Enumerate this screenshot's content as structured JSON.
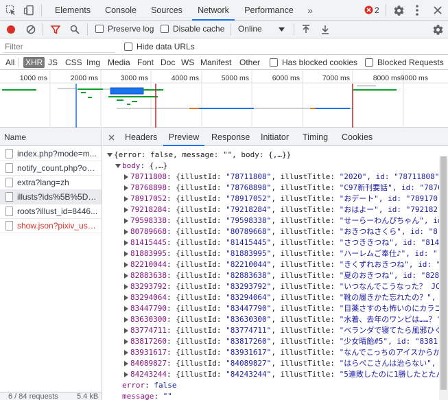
{
  "top_tabs": [
    "Elements",
    "Console",
    "Sources",
    "Network",
    "Performance"
  ],
  "error_count": "2",
  "toolbar": {
    "preserve_log": "Preserve log",
    "disable_cache": "Disable cache",
    "throttle": "Online"
  },
  "filter": {
    "placeholder": "Filter",
    "hide_data_urls": "Hide data URLs"
  },
  "types": [
    "All",
    "XHR",
    "JS",
    "CSS",
    "Img",
    "Media",
    "Font",
    "Doc",
    "WS",
    "Manifest",
    "Other"
  ],
  "has_blocked_cookies": "Has blocked cookies",
  "blocked_requests": "Blocked Requests",
  "timeline_ticks": [
    "1000 ms",
    "2000 ms",
    "3000 ms",
    "4000 ms",
    "5000 ms",
    "6000 ms",
    "7000 ms",
    "8000 ms",
    "9000 ms"
  ],
  "name_header": "Name",
  "requests": [
    "index.php?mode=m...",
    "notify_count.php?op...",
    "extra?lang=zh",
    "illusts?ids%5B%5D=...",
    "roots?illust_id=8446...",
    "show.json?pixiv_use..."
  ],
  "status": {
    "count": "6 / 84 requests",
    "size": "5.4 kB"
  },
  "detail_tabs": [
    "Headers",
    "Preview",
    "Response",
    "Initiator",
    "Timing",
    "Cookies"
  ],
  "preview": {
    "root": "{error: false, message: \"\", body: {,…}}",
    "body_key": "body",
    "body_summary": "{,…}",
    "items": [
      {
        "id": "78711808",
        "title": "\"2020\", id: \"78711808\""
      },
      {
        "id": "78768898",
        "title": "\"C97新刊要話\", id: \"7876"
      },
      {
        "id": "78917052",
        "title": "\"おデート\", id: \"789170"
      },
      {
        "id": "79218284",
        "title": "\"おはよー\", id: \"792182"
      },
      {
        "id": "79598338",
        "title": "\"せーらーわんぴちゃん\", id"
      },
      {
        "id": "80789668",
        "title": "\"おきつねさくら\", id: \"8"
      },
      {
        "id": "81415445",
        "title": "\"さつききつね\", id: \"814"
      },
      {
        "id": "81883995",
        "title": "\"ハーレムご奉仕♪\", id: \""
      },
      {
        "id": "82210044",
        "title": "\"きくずれおきつね\", id: \""
      },
      {
        "id": "82883638",
        "title": "\"夏のおきつね\", id: \"828"
      },
      {
        "id": "83293792",
        "title": "\"いつなんでこうなった？ JC"
      },
      {
        "id": "83294064",
        "title": "\"靴の履きかた忘れたの？\","
      },
      {
        "id": "83447790",
        "title": "\"目薬さすのも怖いのにカラコ"
      },
      {
        "id": "83630300",
        "title": "\"水着、去年のワンピは……？'"
      },
      {
        "id": "83774711",
        "title": "\"ベランダで寝てたら風邪ひく"
      },
      {
        "id": "83817260",
        "title": "\"少女晴飴#5\", id: \"8381"
      },
      {
        "id": "83931617",
        "title": "\"なんでこっちのアイスからか"
      },
      {
        "id": "84089827",
        "title": "\"はらぺこさんは治らない\","
      },
      {
        "id": "84243244",
        "title": "\"5連敗したのに1勝したとたん"
      }
    ],
    "error_line": {
      "key": "error",
      "value": "false"
    },
    "message_line": {
      "key": "message",
      "value": "\"\""
    }
  }
}
